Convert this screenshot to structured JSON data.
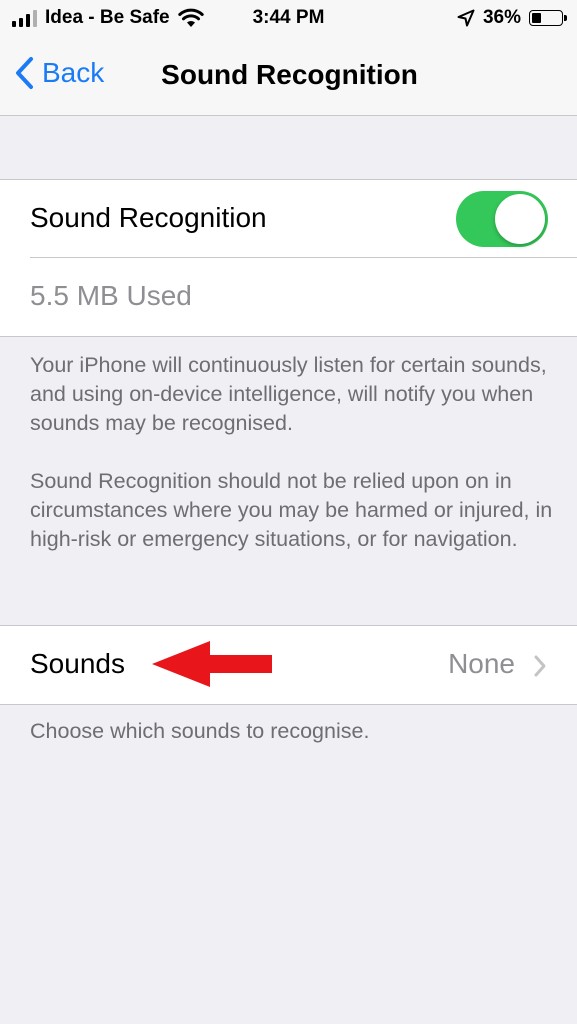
{
  "status_bar": {
    "carrier": "Idea - Be Safe",
    "time": "3:44 PM",
    "battery": "36%",
    "icons": [
      "signal-bars-icon",
      "wifi-icon",
      "location-arrow-icon",
      "battery-icon"
    ]
  },
  "nav": {
    "back_label": "Back",
    "title": "Sound Recognition"
  },
  "settings": {
    "toggle_label": "Sound Recognition",
    "toggle_on": true,
    "storage_used": "5.5 MB Used",
    "description_1": "Your iPhone will continuously listen for certain sounds, and using on-device intelligence, will notify you when sounds may be recognised.",
    "description_2": "Sound Recognition should not be relied upon on in circumstances where you may be harmed or injured, in high-risk or emergency situations, or for navigation.",
    "sounds_label": "Sounds",
    "sounds_value": "None",
    "sounds_footer": "Choose which sounds to recognise."
  },
  "colors": {
    "accent": "#1a7cf5",
    "toggle_on": "#34c759",
    "annotation_arrow": "#e8151b"
  }
}
